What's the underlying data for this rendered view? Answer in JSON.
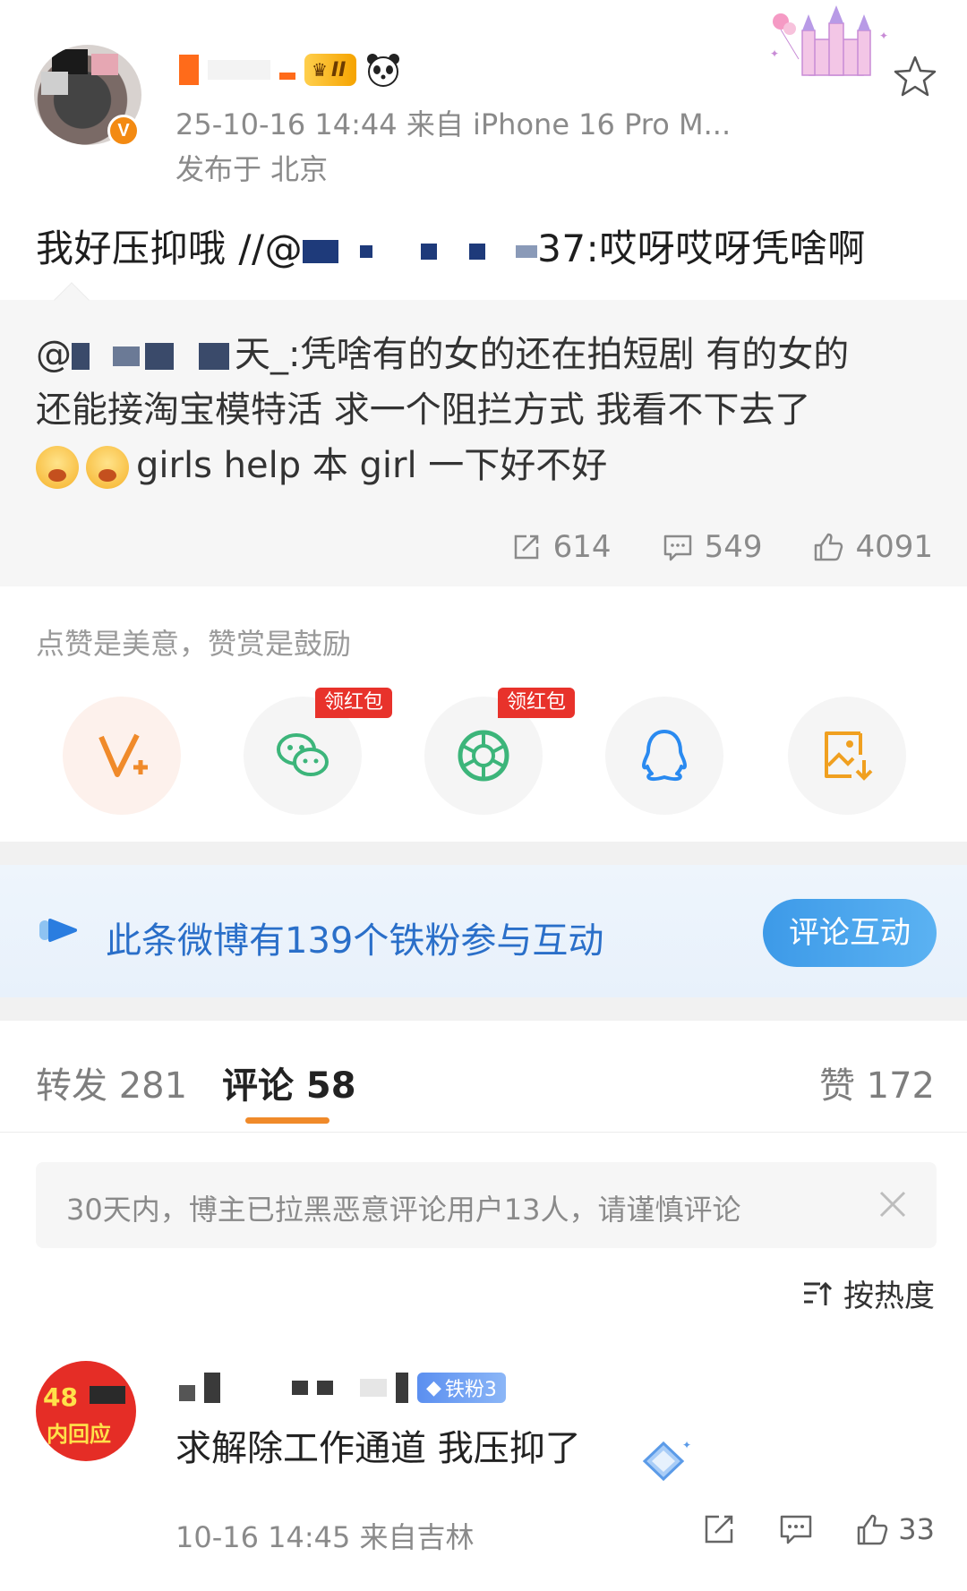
{
  "post": {
    "meta_time_source": "25-10-16 14:44  来自 iPhone 16 Pro M...",
    "location": "发布于 北京",
    "vip_level": "II",
    "verified_mark": "V",
    "text_prefix": "我好压抑哦 //@",
    "text_suffix": "37:哎呀哎呀凭啥啊"
  },
  "quote": {
    "at": "@",
    "name_tail": "天_",
    "line1": ":凭啥有的女的还在拍短剧 有的女的",
    "line2": "还能接淘宝模特活  求一个阻拦方式 我看不下去了",
    "line3": "girls help 本 girl 一下好不好",
    "reposts": "614",
    "comments": "549",
    "likes": "4091"
  },
  "reward": {
    "tip": "点赞是美意，赞赏是鼓励",
    "hongbao_label": "领红包"
  },
  "share_icons": [
    "v-plus-icon",
    "wechat-icon",
    "moments-icon",
    "qq-icon",
    "save-image-icon"
  ],
  "fan_banner": {
    "text": "此条微博有139个铁粉参与互动",
    "button": "评论互动"
  },
  "tabs": {
    "repost": "转发 281",
    "comment": "评论 58",
    "like": "赞 172"
  },
  "notice": {
    "text": "30天内，博主已拉黑恶意评论用户13人，请谨慎评论"
  },
  "sort": {
    "label": "按热度"
  },
  "comment": {
    "avatar_line1": "48",
    "avatar_line2": "内回应",
    "fan_badge": "铁粉3",
    "text": "求解除工作通道 我压抑了",
    "meta": "10-16 14:45  来自吉林",
    "likes": "33"
  },
  "colors": {
    "accent_orange": "#f08a2a",
    "link_blue": "#2a6fc9",
    "hongbao_red": "#e8322b"
  }
}
